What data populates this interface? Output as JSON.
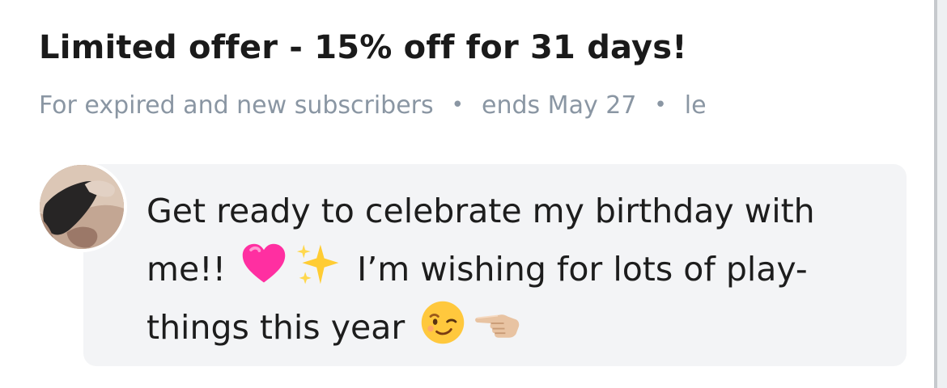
{
  "offer": {
    "title": "Limited offer - 15% off for 31 days!",
    "meta": {
      "audience": "For expired and new subscribers",
      "separator": "•",
      "ends": "ends May 27",
      "remaining": "le"
    }
  },
  "post": {
    "avatar": "profile-photo",
    "message_parts": [
      "Get ready to celebrate my birthday with me!! ",
      " I’m wishing for lots of play-things this year "
    ],
    "emojis": [
      "pink-heart-icon",
      "sparkles-icon",
      "winking-face-icon",
      "pointing-left-hand-icon"
    ]
  },
  "colors": {
    "title": "#1a1a1a",
    "meta": "#8a96a3",
    "bubble": "#f3f4f6",
    "message": "#1d1d1d",
    "heart": "#ff2fa1",
    "sparkles": "#ffcc33",
    "wink": "#ffc83d"
  }
}
